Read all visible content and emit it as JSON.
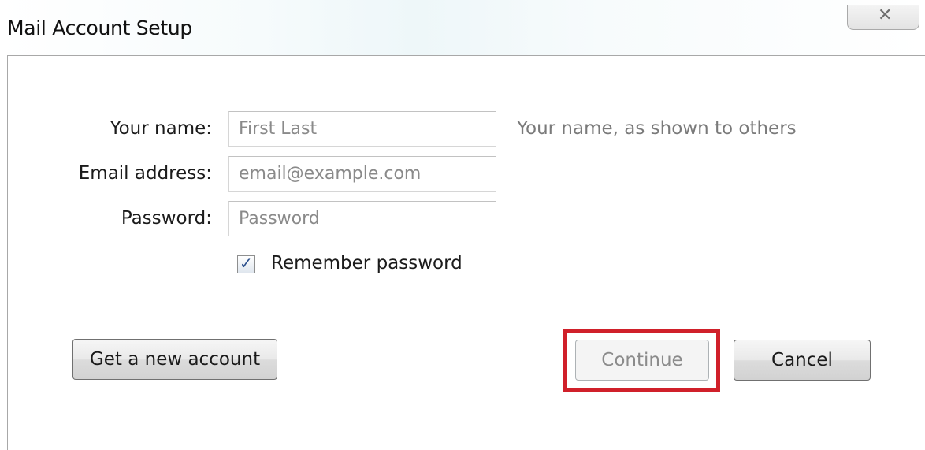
{
  "window": {
    "title": "Mail Account Setup",
    "close_glyph": "✕"
  },
  "form": {
    "name": {
      "label": "Your name:",
      "placeholder": "First Last",
      "value": ""
    },
    "name_hint": "Your name, as shown to others",
    "email": {
      "label": "Email address:",
      "placeholder": "email@example.com",
      "value": ""
    },
    "password": {
      "label": "Password:",
      "placeholder": "Password",
      "value": ""
    },
    "remember": {
      "label": "Remember password",
      "checked": true,
      "glyph": "✓"
    }
  },
  "buttons": {
    "get_account": "Get a new account",
    "continue": "Continue",
    "cancel": "Cancel"
  },
  "highlight": {
    "target": "continue-button",
    "color": "#d0202a"
  },
  "icons": {
    "close": "close-icon",
    "check": "check-icon"
  }
}
